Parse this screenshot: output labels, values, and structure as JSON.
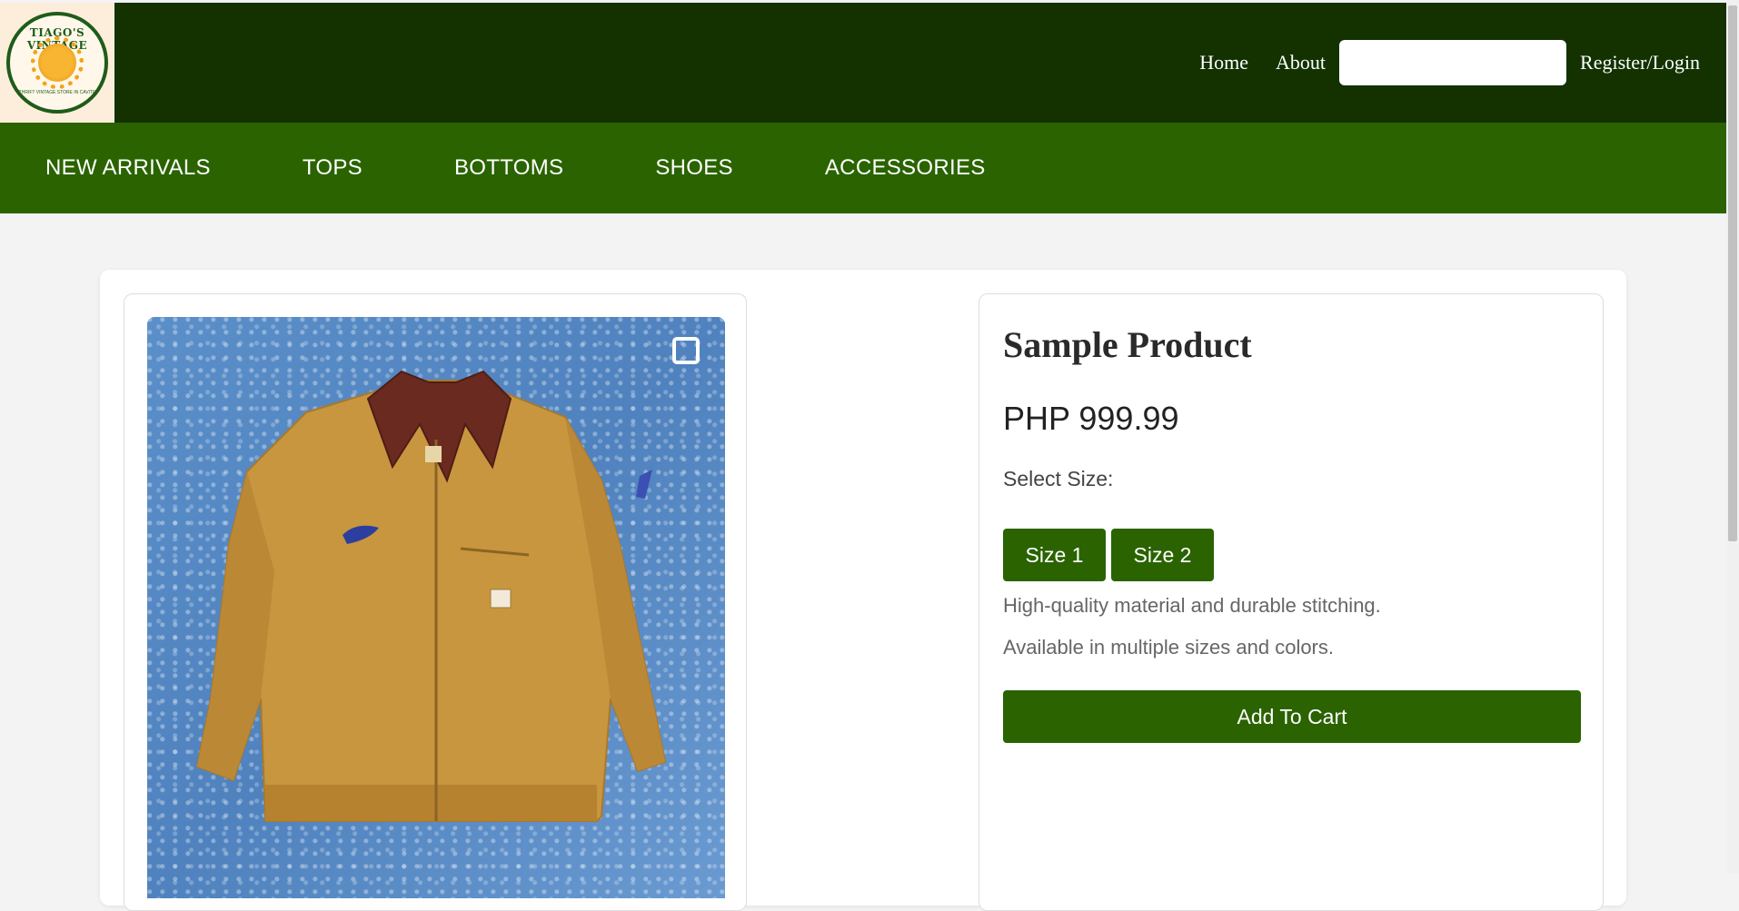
{
  "header": {
    "logo_text": "TIAGO'S VINTAGE",
    "logo_subtext": "THRIFT VINTAGE STORE IN CAVITE",
    "nav": {
      "home": "Home",
      "about": "About",
      "register_login": "Register/Login"
    },
    "search": {
      "value": "",
      "placeholder": ""
    }
  },
  "categories": [
    "NEW ARRIVALS",
    "TOPS",
    "BOTTOMS",
    "SHOES",
    "ACCESSORIES"
  ],
  "product": {
    "title": "Sample Product",
    "price": "PHP 999.99",
    "select_size_label": "Select Size:",
    "sizes": [
      "Size 1",
      "Size 2"
    ],
    "description": [
      "High-quality material and durable stitching.",
      "Available in multiple sizes and colors."
    ],
    "add_to_cart_label": "Add To Cart"
  },
  "colors": {
    "header_bg": "#133200",
    "category_bg": "#2a6300",
    "button_bg": "#2a6300",
    "page_bg": "#f3f3f3"
  }
}
